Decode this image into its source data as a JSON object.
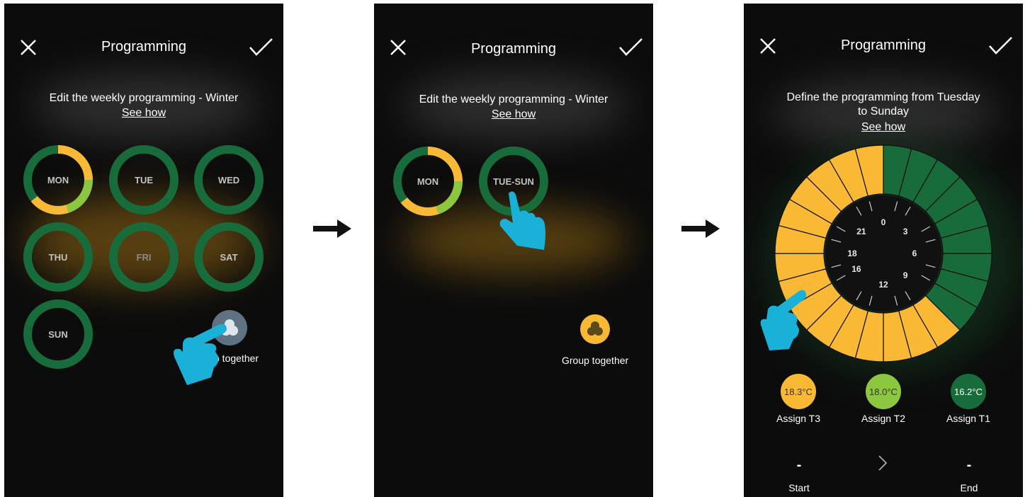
{
  "colors": {
    "yellow": "#f9b934",
    "green": "#186b3a",
    "lightgreen": "#8dc63f",
    "hand": "#1ab1d8",
    "bg": "#0c0c0c"
  },
  "screen1": {
    "title": "Programming",
    "subtitle": "Edit the weekly programming - Winter",
    "see_how": "See how",
    "days": [
      "MON",
      "TUE",
      "WED",
      "THU",
      "FRI",
      "SAT",
      "SUN"
    ],
    "group_label": "p together"
  },
  "screen2": {
    "title": "Programming",
    "subtitle": "Edit the weekly programming - Winter",
    "see_how": "See how",
    "days": [
      "MON",
      "TUE-SUN"
    ],
    "group_label": "Group together"
  },
  "screen3": {
    "title": "Programming",
    "subtitle_line1": "Define the programming from Tuesday",
    "subtitle_line2": "to Sunday",
    "see_how": "See how",
    "dial_hours": [
      "0",
      "3",
      "6",
      "9",
      "12",
      "16",
      "18",
      "21"
    ],
    "temps": [
      {
        "value": "18.3°C",
        "assign": "Assign T3"
      },
      {
        "value": "18.0°C",
        "assign": "Assign T2"
      },
      {
        "value": "16.2°C",
        "assign": "Assign T1"
      }
    ],
    "start_value": "-",
    "end_value": "-",
    "start_label": "Start",
    "end_label": "End",
    "next_icon": "chevron-right-icon"
  }
}
